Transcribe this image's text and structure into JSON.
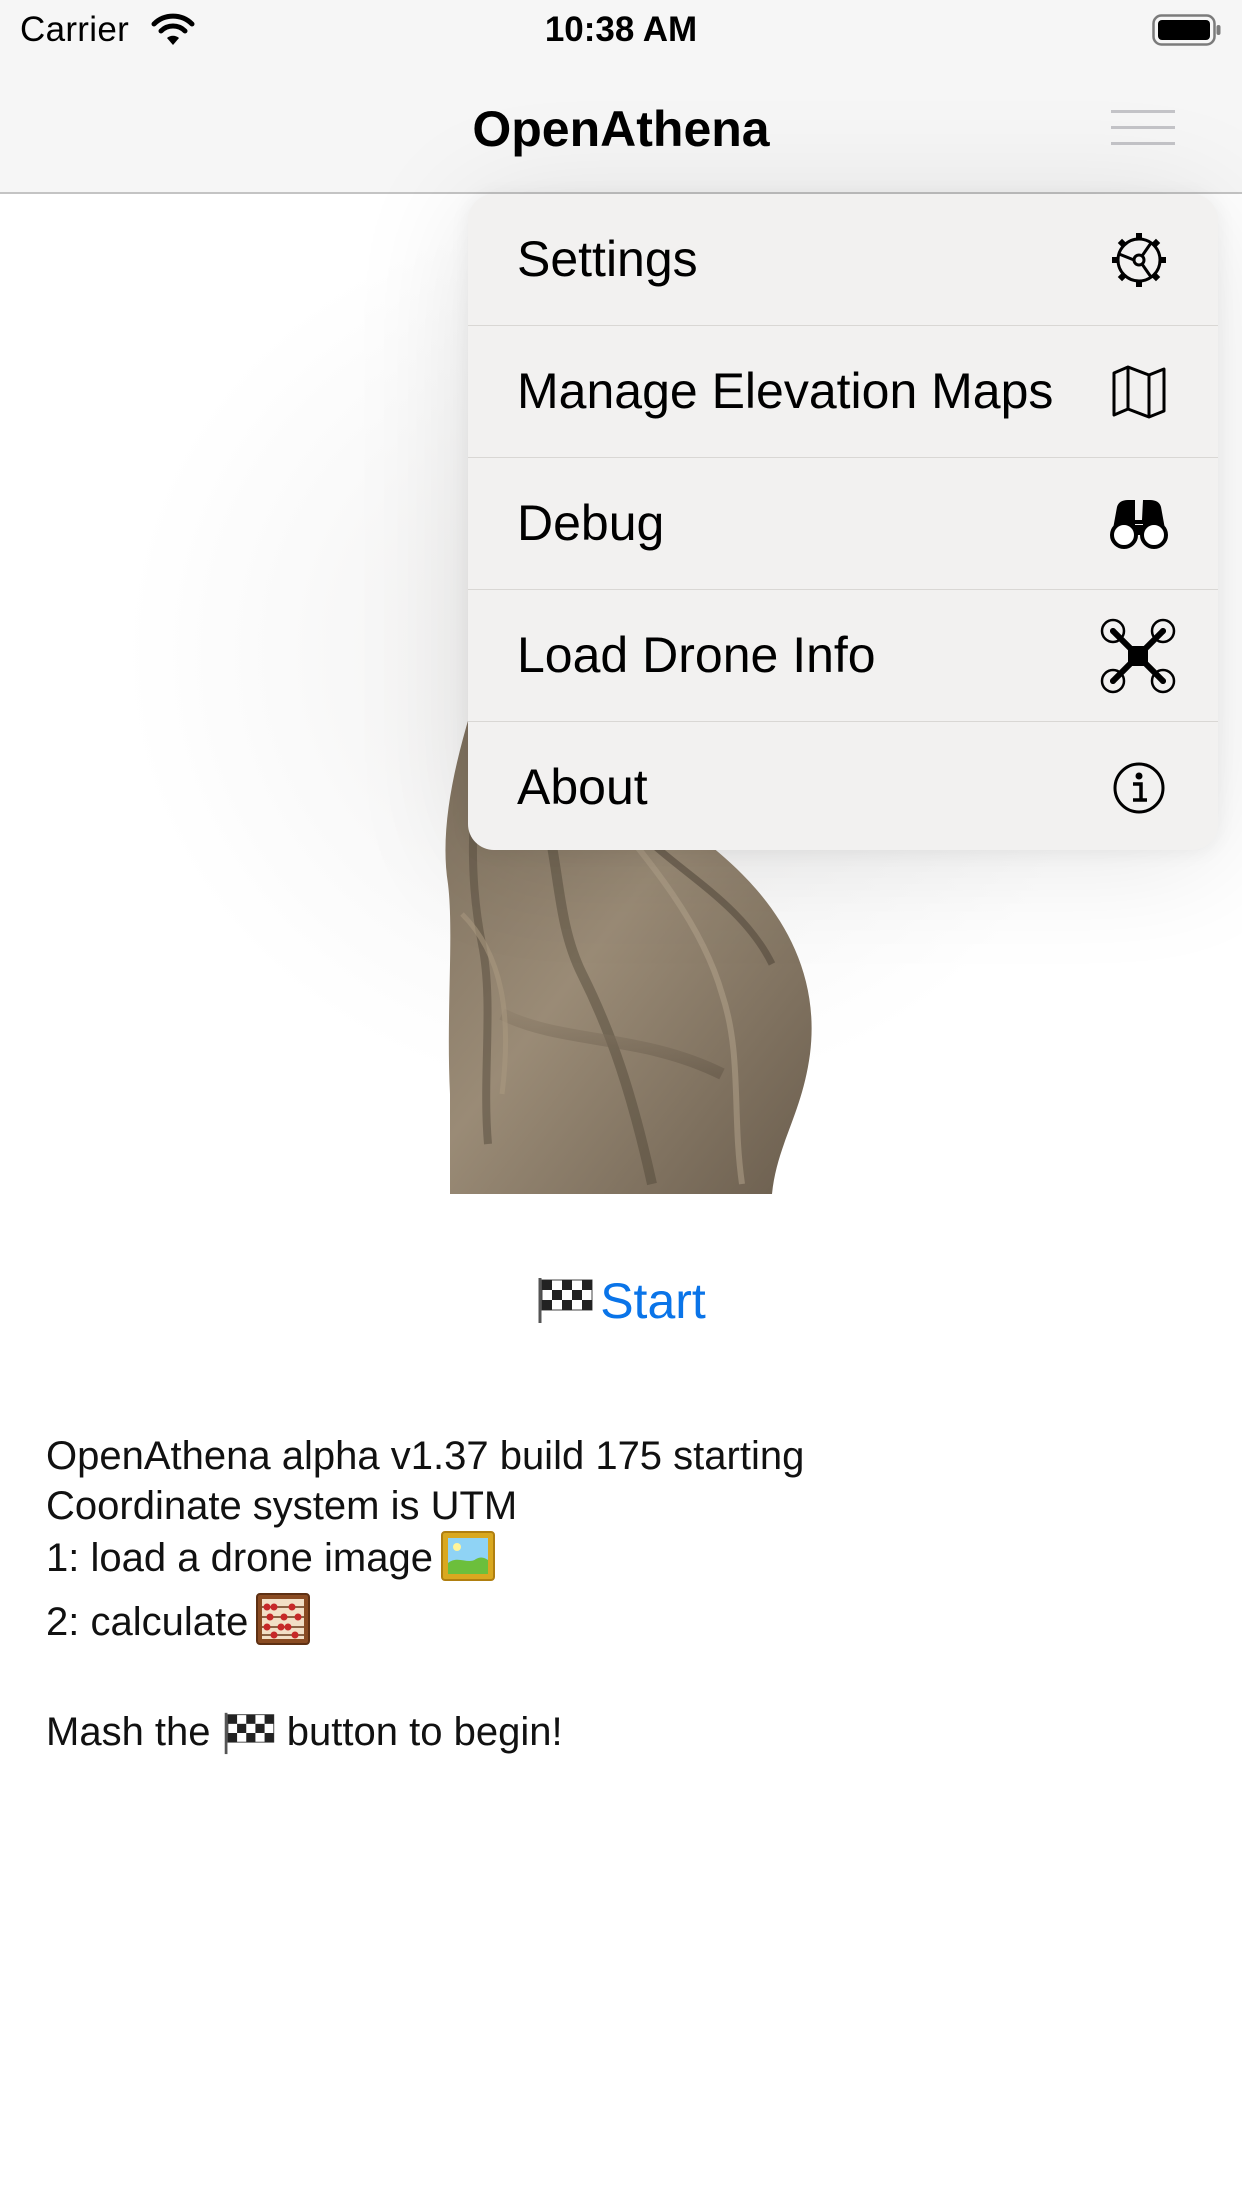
{
  "status_bar": {
    "carrier": "Carrier",
    "time": "10:38 AM",
    "wifi_icon": "wifi-icon",
    "battery_icon": "battery-icon"
  },
  "nav": {
    "title": "OpenAthena",
    "menu_icon": "hamburger-menu-icon"
  },
  "menu": {
    "items": [
      {
        "label": "Settings",
        "icon": "gear-icon"
      },
      {
        "label": "Manage Elevation Maps",
        "icon": "map-icon"
      },
      {
        "label": "Debug",
        "icon": "binoculars-icon"
      },
      {
        "label": "Load Drone Info",
        "icon": "drone-icon"
      },
      {
        "label": "About",
        "icon": "info-icon"
      }
    ]
  },
  "main": {
    "start_flag": "🏁",
    "start_label": "Start",
    "log": {
      "line1": "OpenAthena alpha v1.37 build 175 starting",
      "line2": "Coordinate system is UTM",
      "line3": "1: load a drone image",
      "line3_emoji": "🖼️",
      "line4": "2: calculate",
      "line4_emoji": "🧮",
      "line5_pre": "Mash the",
      "line5_emoji": "🏁",
      "line5_post": "button to begin!"
    }
  },
  "colors": {
    "accent": "#0a74e8",
    "nav_background": "#f6f6f6",
    "menu_background": "#f2f1f0"
  }
}
